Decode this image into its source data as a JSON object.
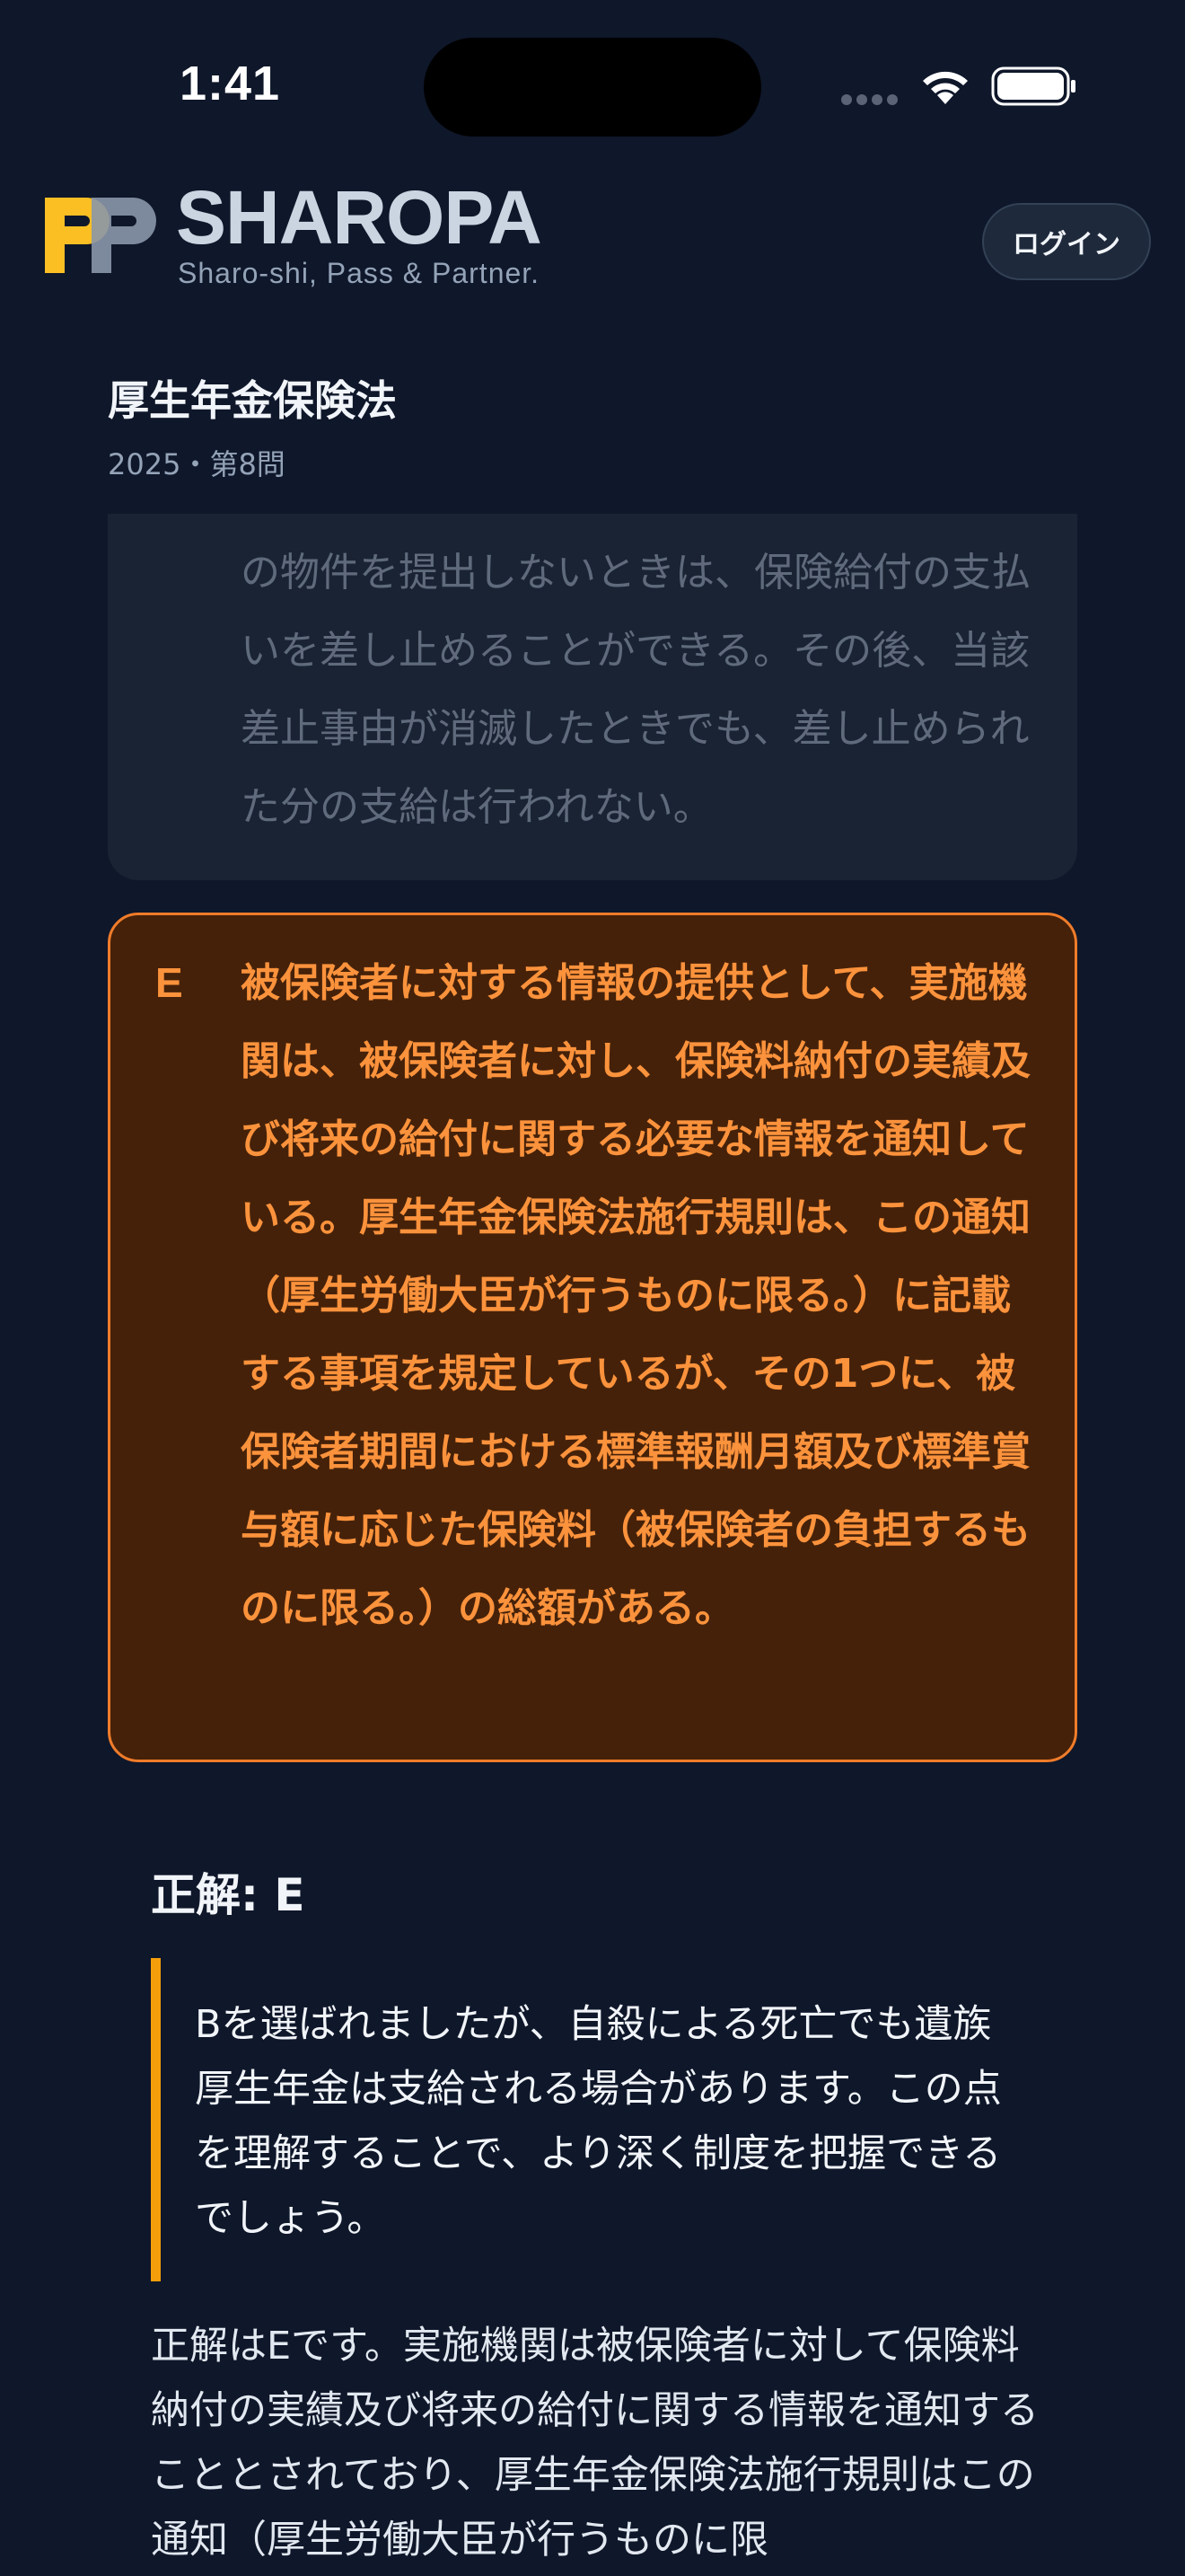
{
  "status_bar": {
    "time": "1:41"
  },
  "header": {
    "logo_icon": "sharopa-pp-logo",
    "brand_name": "SHAROPA",
    "tagline": "Sharo-shi, Pass & Partner.",
    "login_label": "ログイン"
  },
  "page": {
    "title": "厚生年金保険法",
    "subtitle": "2025・第8問"
  },
  "options": {
    "d": {
      "text": "の物件を提出しないときは、保険給付の支払いを差し止めることができる。その後、当該差止事由が消滅したときでも、差し止められた分の支給は行われない。"
    },
    "e": {
      "letter": "E",
      "text": "被保険者に対する情報の提供として、実施機関は、被保険者に対し、保険料納付の実績及び将来の給付に関する必要な情報を通知している。厚生年金保険法施行規則は、この通知（厚生労働大臣が行うものに限る。）に記載する事項を規定しているが、その1つに、被保険者期間における標準報酬月額及び標準賞与額に応じた保険料（被保険者の負担するものに限る。）の総額がある。",
      "selected_color": "#fb923c"
    }
  },
  "answer": {
    "heading": "正解: E",
    "feedback": "Bを選ばれましたが、自殺による死亡でも遺族厚生年金は支給される場合があります。この点を理解することで、より深く制度を把握できるでしょう。",
    "explanation": "正解はEです。実施機関は被保険者に対して保険料納付の実績及び将来の給付に関する情報を通知することとされており、厚生年金保険法施行規則はこの通知（厚生労働大臣が行うものに限"
  },
  "colors": {
    "background": "#0f172a",
    "accent_orange": "#f07c2a",
    "accent_amber": "#f59e0b",
    "logo_yellow": "#fbbf24"
  }
}
